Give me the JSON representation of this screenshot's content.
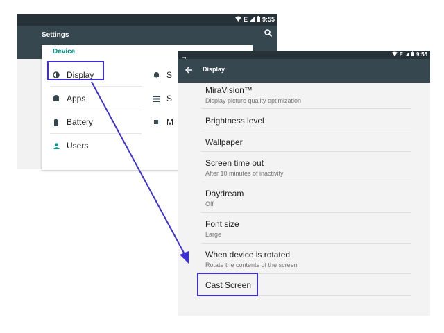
{
  "settings_screen": {
    "status_time": "9:55",
    "network_label": "E",
    "title": "Settings",
    "section_header": "Device",
    "items": [
      {
        "label": "Display",
        "icon": "brightness-icon"
      },
      {
        "label": "Apps",
        "icon": "android-icon"
      },
      {
        "label": "Battery",
        "icon": "battery-icon"
      },
      {
        "label": "Users",
        "icon": "person-icon"
      }
    ],
    "right_items": [
      {
        "label": "S",
        "icon": "bell-icon"
      },
      {
        "label": "S",
        "icon": "storage-icon"
      },
      {
        "label": "M",
        "icon": "memory-icon"
      }
    ]
  },
  "display_screen": {
    "status_time": "9:55",
    "network_label": "E",
    "title": "Display",
    "prefs": [
      {
        "title": "MiraVision™",
        "summary": "Display picture quality optimization"
      },
      {
        "title": "Brightness level",
        "summary": ""
      },
      {
        "title": "Wallpaper",
        "summary": ""
      },
      {
        "title": "Screen time out",
        "summary": "After 10 minutes of inactivity"
      },
      {
        "title": "Daydream",
        "summary": "Off"
      },
      {
        "title": "Font size",
        "summary": "Large"
      },
      {
        "title": "When device is rotated",
        "summary": "Rotate the contents of the screen"
      },
      {
        "title": "Cast Screen",
        "summary": ""
      }
    ]
  },
  "colors": {
    "toolbar": "#37474f",
    "statusbar": "#263238",
    "accent": "#009688",
    "highlight": "#3b2fd6"
  }
}
